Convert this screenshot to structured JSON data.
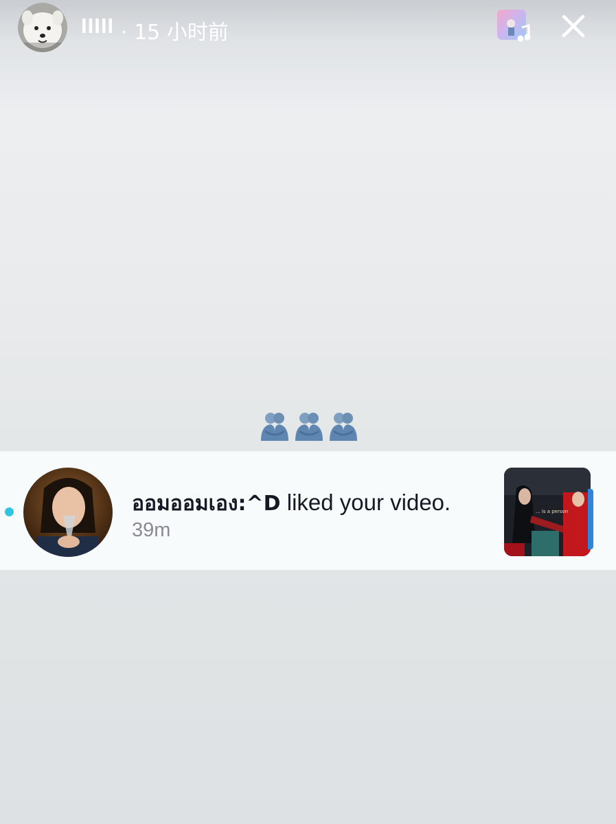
{
  "header": {
    "username": "IIIII",
    "timestamp": "· 15 小时前",
    "avatar_icon": "samoyed-dog-avatar",
    "music_icon": "music-note-icon",
    "close_icon": "close-icon"
  },
  "reaction": {
    "emoji": "hugging-people-emoji",
    "count": 3
  },
  "notification": {
    "actor": "ออมออมเอง:^D",
    "action": " liked your video.",
    "time": "39m",
    "unread": true,
    "thumbnail_caption": "... is a person"
  },
  "colors": {
    "unread_dot": "#31c3e0",
    "notification_bg": "#f8fbfc",
    "primary_text": "#161823",
    "secondary_text": "#8a8b91"
  }
}
